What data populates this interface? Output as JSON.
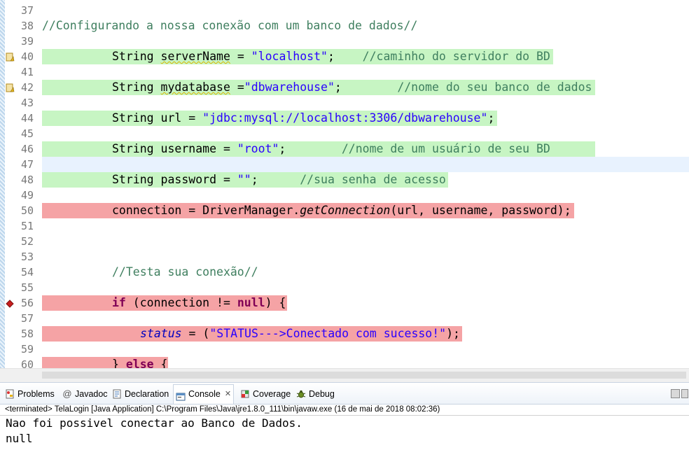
{
  "editor": {
    "lines": [
      {
        "num": "37",
        "hl": "",
        "indent": 0,
        "marker": "",
        "tokens": []
      },
      {
        "num": "38",
        "hl": "",
        "indent": 0,
        "marker": "",
        "tokens": [
          {
            "t": "//Configurando a nossa conexão com um banco de dados//",
            "c": "cm"
          }
        ]
      },
      {
        "num": "39",
        "hl": "",
        "indent": 0,
        "marker": "",
        "tokens": []
      },
      {
        "num": "40",
        "hl": "green",
        "indent": 100,
        "marker": "warning",
        "tokens": [
          {
            "t": "String ",
            "c": ""
          },
          {
            "t": "serverName",
            "c": "warn-under"
          },
          {
            "t": " = ",
            "c": ""
          },
          {
            "t": "\"localhost\"",
            "c": "st"
          },
          {
            "t": ";    ",
            "c": ""
          },
          {
            "t": "//caminho do servidor do BD",
            "c": "cm"
          }
        ]
      },
      {
        "num": "41",
        "hl": "",
        "indent": 0,
        "marker": "",
        "tokens": []
      },
      {
        "num": "42",
        "hl": "green",
        "indent": 100,
        "marker": "warning",
        "tokens": [
          {
            "t": "String ",
            "c": ""
          },
          {
            "t": "mydatabase",
            "c": "warn-under"
          },
          {
            "t": " =",
            "c": ""
          },
          {
            "t": "\"dbwarehouse\"",
            "c": "st"
          },
          {
            "t": ";        ",
            "c": ""
          },
          {
            "t": "//nome do seu banco de dados",
            "c": "cm"
          }
        ]
      },
      {
        "num": "43",
        "hl": "",
        "indent": 0,
        "marker": "",
        "tokens": []
      },
      {
        "num": "44",
        "hl": "green",
        "indent": 100,
        "marker": "",
        "tokens": [
          {
            "t": "String url = ",
            "c": ""
          },
          {
            "t": "\"jdbc:mysql://localhost:3306/dbwarehouse\"",
            "c": "st"
          },
          {
            "t": ";",
            "c": ""
          }
        ]
      },
      {
        "num": "45",
        "hl": "",
        "indent": 0,
        "marker": "",
        "tokens": []
      },
      {
        "num": "46",
        "hl": "green",
        "indent": 100,
        "marker": "",
        "tokens": [
          {
            "t": "String username = ",
            "c": ""
          },
          {
            "t": "\"root\"",
            "c": "st"
          },
          {
            "t": ";        ",
            "c": ""
          },
          {
            "t": "//nome de um usuário de seu BD",
            "c": "cm"
          }
        ]
      },
      {
        "num": "47",
        "hl": "current",
        "indent": 0,
        "marker": "",
        "tokens": []
      },
      {
        "num": "48",
        "hl": "green",
        "indent": 100,
        "marker": "",
        "tokens": [
          {
            "t": "String password = ",
            "c": ""
          },
          {
            "t": "\"\"",
            "c": "st"
          },
          {
            "t": ";      ",
            "c": ""
          },
          {
            "t": "//sua senha de acesso",
            "c": "cm"
          }
        ]
      },
      {
        "num": "49",
        "hl": "",
        "indent": 0,
        "marker": "",
        "tokens": []
      },
      {
        "num": "50",
        "hl": "red",
        "indent": 100,
        "marker": "",
        "tokens": [
          {
            "t": "connection = DriverManager.",
            "c": ""
          },
          {
            "t": "getConnection",
            "c": "mi"
          },
          {
            "t": "(url, username, password);",
            "c": ""
          }
        ]
      },
      {
        "num": "51",
        "hl": "",
        "indent": 0,
        "marker": "",
        "tokens": []
      },
      {
        "num": "52",
        "hl": "",
        "indent": 0,
        "marker": "",
        "tokens": []
      },
      {
        "num": "53",
        "hl": "",
        "indent": 0,
        "marker": "",
        "tokens": []
      },
      {
        "num": "54",
        "hl": "",
        "indent": 100,
        "marker": "",
        "tokens": [
          {
            "t": "//Testa sua conexão//",
            "c": "cm"
          }
        ]
      },
      {
        "num": "55",
        "hl": "",
        "indent": 0,
        "marker": "",
        "tokens": []
      },
      {
        "num": "56",
        "hl": "red",
        "indent": 100,
        "marker": "breakpoint",
        "tokens": [
          {
            "t": "if",
            "c": "kw"
          },
          {
            "t": " (connection != ",
            "c": ""
          },
          {
            "t": "null",
            "c": "kw"
          },
          {
            "t": ") {",
            "c": ""
          }
        ]
      },
      {
        "num": "57",
        "hl": "",
        "indent": 0,
        "marker": "",
        "tokens": []
      },
      {
        "num": "58",
        "hl": "red",
        "indent": 140,
        "marker": "",
        "tokens": [
          {
            "t": "status",
            "c": "fd"
          },
          {
            "t": " = (",
            "c": ""
          },
          {
            "t": "\"STATUS--->Conectado com sucesso!\"",
            "c": "st"
          },
          {
            "t": ");",
            "c": ""
          }
        ]
      },
      {
        "num": "59",
        "hl": "",
        "indent": 0,
        "marker": "",
        "tokens": []
      },
      {
        "num": "60",
        "hl": "red",
        "indent": 100,
        "marker": "",
        "tokens": [
          {
            "t": "} ",
            "c": ""
          },
          {
            "t": "else",
            "c": "kw"
          },
          {
            "t": " {",
            "c": ""
          }
        ]
      }
    ]
  },
  "views": {
    "tabs": [
      {
        "label": "Problems",
        "icon": "problems-icon",
        "active": false
      },
      {
        "label": "Javadoc",
        "icon": "javadoc-icon",
        "active": false
      },
      {
        "label": "Declaration",
        "icon": "declaration-icon",
        "active": false
      },
      {
        "label": "Console",
        "icon": "console-icon",
        "active": true,
        "close": "✕"
      },
      {
        "label": "Coverage",
        "icon": "coverage-icon",
        "active": false
      },
      {
        "label": "Debug",
        "icon": "debug-icon",
        "active": false
      }
    ]
  },
  "console": {
    "header": "<terminated> TelaLogin [Java Application] C:\\Program Files\\Java\\jre1.8.0_111\\bin\\javaw.exe (16 de mai de 2018 08:02:36)",
    "output": [
      "Nao foi possivel conectar ao Banco de Dados.",
      "null"
    ]
  }
}
